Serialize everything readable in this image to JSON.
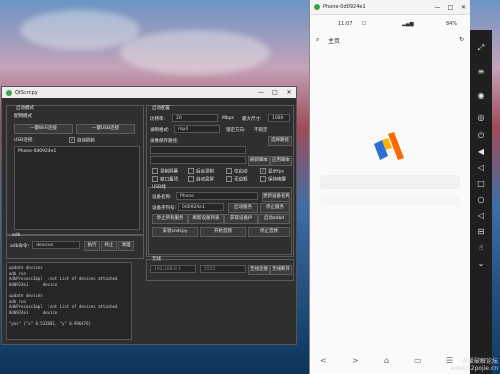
{
  "app": {
    "title": "QtScrcpy",
    "window_controls": [
      "—",
      "□",
      "✕"
    ]
  },
  "left": {
    "launch_mode_label": "启动模式",
    "mode_title": "配网模式",
    "wifi_connect_btn": "一键WiFi连接",
    "usb_connect_btn": "一键USB连接",
    "auto_connect_label": "USB连接: ",
    "auto_refresh_label": "自动刷新",
    "device_list": [
      "Phone-0d0924e1"
    ],
    "adb_label": "adb",
    "adb_cmd_label": "adb命令: ",
    "adb_cmd_value": "devices",
    "exec_btn": "执行",
    "stop_btn": "终止",
    "clear_btn": "清理",
    "log_text": "update devices\nadb run\nAdbProcessImpl  :not List of devices attached\n0d0924e1      device\n\nupdate devices\nadb run\nAdbProcessImpl  :not List of devices attached\n0d0924e1      device\n\n\"pos\" {\"x\" 0.532081, \"y\" 0.996476}"
  },
  "right": {
    "group_title": "启动配置",
    "bitrate_label": "比特率: ",
    "bitrate_value": "20",
    "bitrate_unit": "Mbps",
    "max_size_label": "最大尺寸: ",
    "max_size_value": "1080",
    "record_format_label": "录制格式: ",
    "record_format_value": "mp4",
    "lock_orientation_label": "锁定方向: ",
    "lock_orientation_value": "不锁定",
    "record_path_label": "录像保存路径: ",
    "select_path_btn": "选择路径",
    "refresh_script_btn": "刷新脚本",
    "apply_script_btn": "应用脚本",
    "checkboxes": [
      {
        "label": "录制屏幕",
        "checked": false
      },
      {
        "label": "后台录制",
        "checked": false
      },
      {
        "label": "仅启动",
        "checked": false
      },
      {
        "label": "显示fps",
        "checked": true
      },
      {
        "label": "窗口置顶",
        "checked": false
      },
      {
        "label": "自动息屏",
        "checked": false
      },
      {
        "label": "无边框",
        "checked": false
      },
      {
        "label": "保持唤醒",
        "checked": false
      }
    ],
    "usb_group_title": "USB线",
    "device_name_label": "设备名称: ",
    "device_name_value": "Phone",
    "set_name_btn": "更新设备名称",
    "serial_label": "设备序列号: ",
    "serial_value": "0d0924e1",
    "start_server_btn": "启动服务",
    "stop_server_btn": "停止服务",
    "stop_all_btn": "停止所有服务",
    "get_ip_btn": "刷新设备列表",
    "get_device_ip_btn": "获取设备IP",
    "start_adbd_btn": "启动adbd",
    "install_btn": "安装sndcpy",
    "start_audio_btn": "开始音频",
    "stop_audio_btn": "停止音频",
    "wireless_title": "无线",
    "ip_value": "192.168.0.1",
    "port_value": "5555",
    "wireless_connect_btn": "无线连接",
    "wireless_disconnect_btn": "无线断开"
  },
  "phone": {
    "title": "Phone-0d0924e1",
    "status_time": "11:07",
    "status_battery": "84%",
    "home_label": "主页",
    "nav": [
      "<",
      ">",
      "⌂",
      "▭",
      "☰"
    ],
    "accent_colors": [
      "#ff6a00",
      "#2b6fd6",
      "#ffb300"
    ]
  },
  "side_icons": [
    "fullscreen-icon",
    "menu-icon",
    "eye-icon",
    "eye-off-icon",
    "power-icon",
    "volume-up-icon",
    "volume-down-icon",
    "app-switch-icon",
    "home-icon",
    "back-icon",
    "notification-icon",
    "touch-icon",
    "arrow-down-icon"
  ],
  "watermark": {
    "line1": "吾爱破解论坛",
    "line2": "www.52pojie.cn"
  }
}
